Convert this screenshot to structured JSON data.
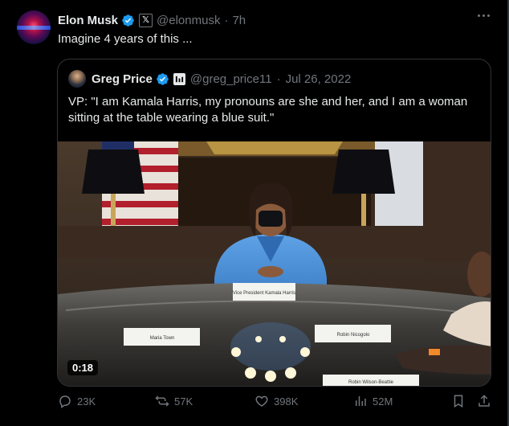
{
  "post": {
    "author_name": "Elon Musk",
    "handle": "@elonmusk",
    "separator": "·",
    "time": "7h",
    "text": "Imagine 4 years of this ..."
  },
  "quote": {
    "author_name": "Greg Price",
    "handle": "@greg_price11",
    "separator": "·",
    "date": "Jul 26, 2022",
    "text": "VP: \"I am Kamala Harris, my pronouns are she and her, and I am a woman sitting at the table wearing a blue suit.\"",
    "video_duration": "0:18",
    "placards": {
      "center": "Vice President Kamala Harris",
      "left": "Maria Town",
      "right": "Robin Wilson-Beattie",
      "right_back": "Robin Nicogolo"
    }
  },
  "actions": {
    "replies": "23K",
    "reposts": "57K",
    "likes": "398K",
    "views": "52M"
  },
  "colors": {
    "background": "#000000",
    "text": "#e7e9ea",
    "muted": "#71767b",
    "verified": "#1d9bf0",
    "border": "#2f3336"
  }
}
